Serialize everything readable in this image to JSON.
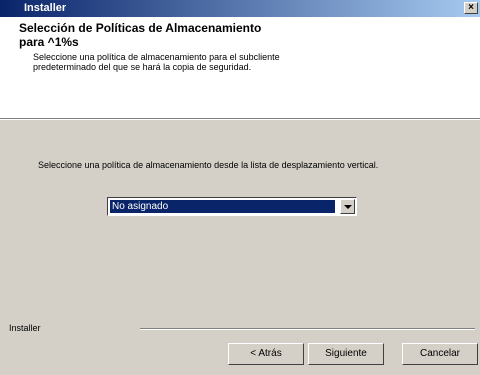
{
  "window": {
    "title": "Installer",
    "close_glyph": "×"
  },
  "header": {
    "title": "Selección de Políticas de Almacenamiento para ^1%s",
    "subtitle": "Seleccione una política de almacenamiento para el subcliente predeterminado del que se hará la copia de seguridad."
  },
  "main": {
    "instruction": "Seleccione una política de almacenamiento desde la lista de desplazamiento vertical.",
    "policy_select": {
      "selected": "No asignado"
    }
  },
  "footer": {
    "label": "Installer",
    "back_label": "< Atrás",
    "next_label": "Siguiente",
    "cancel_label": "Cancelar"
  },
  "colors": {
    "titlebar_start": "#0a246a",
    "titlebar_end": "#a6caf0",
    "dialog_bg": "#d4d0c8",
    "selection_bg": "#0a246a"
  },
  "icons": {
    "close": "close-icon",
    "dropdown": "chevron-down-icon"
  }
}
